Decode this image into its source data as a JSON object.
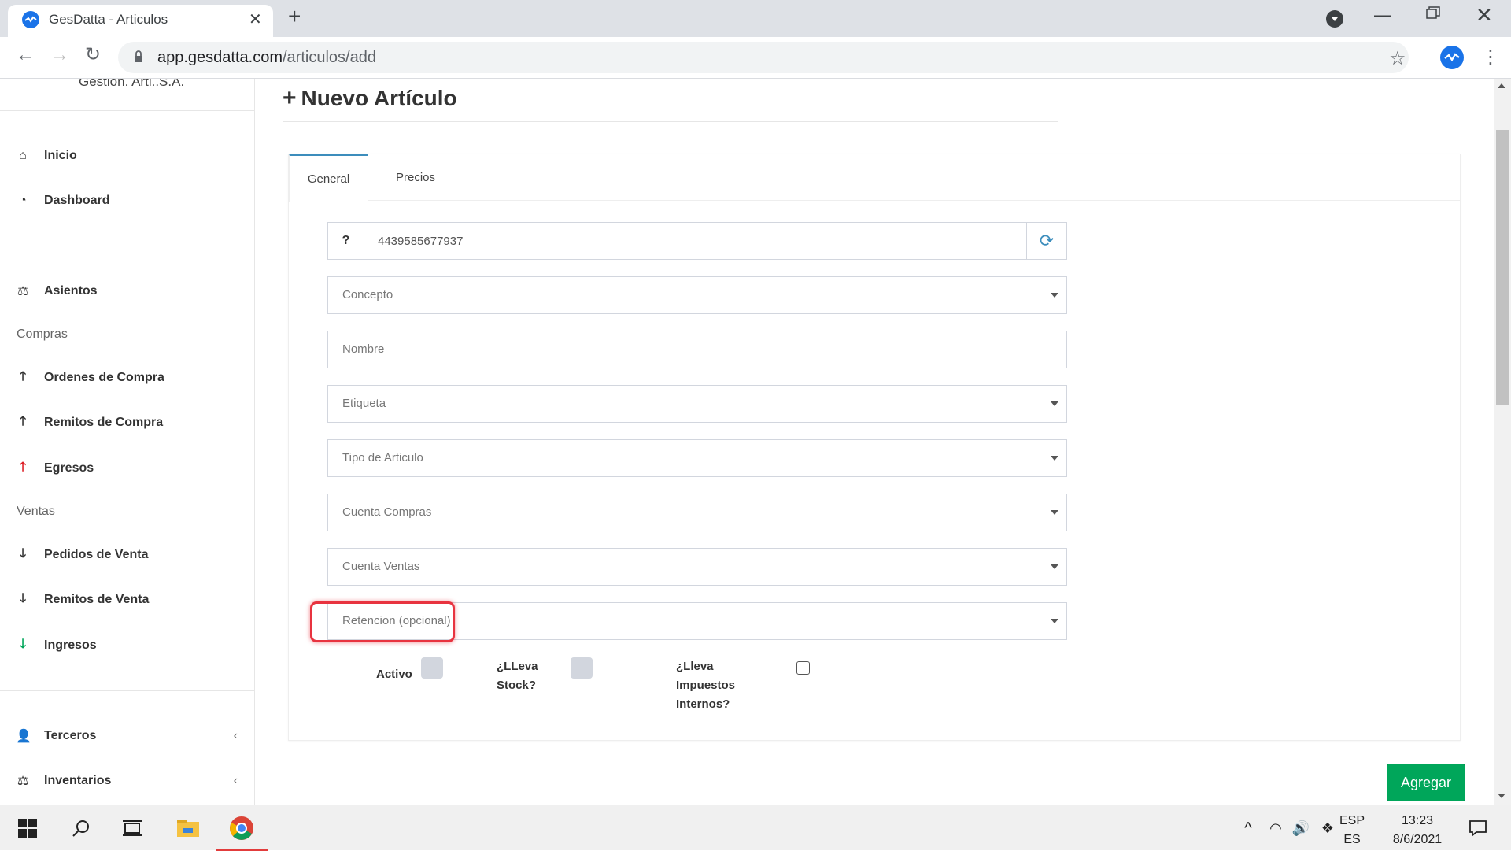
{
  "browser": {
    "tab_title": "GesDatta - Articulos",
    "url_host": "app.gesdatta.com",
    "url_path": "/articulos/add"
  },
  "sidebar": {
    "top_text": "Gestion. Arti..S.A.",
    "items_top": [
      {
        "label": "Inicio",
        "icon": "home-icon"
      },
      {
        "label": "Dashboard",
        "icon": "tachometer-icon"
      }
    ],
    "asientos": {
      "label": "Asientos",
      "icon": "balance-scale-icon"
    },
    "compras_header": "Compras",
    "compras": [
      {
        "label": "Ordenes de Compra",
        "icon": "arrow-up-icon"
      },
      {
        "label": "Remitos de Compra",
        "icon": "arrow-up-icon"
      },
      {
        "label": "Egresos",
        "icon": "arrow-up-red-icon"
      }
    ],
    "ventas_header": "Ventas",
    "ventas": [
      {
        "label": "Pedidos de Venta",
        "icon": "arrow-down-icon"
      },
      {
        "label": "Remitos de Venta",
        "icon": "arrow-down-icon"
      },
      {
        "label": "Ingresos",
        "icon": "arrow-down-green-icon"
      }
    ],
    "bottom": [
      {
        "label": "Terceros",
        "icon": "user-plus-icon"
      },
      {
        "label": "Inventarios",
        "icon": "balance-scale-icon"
      }
    ]
  },
  "main": {
    "title": "Nuevo Artículo",
    "tabs": [
      "General",
      "Precios"
    ],
    "code": {
      "help": "?",
      "value": "4439585677937"
    },
    "fields": {
      "concepto": "Concepto",
      "nombre": "Nombre",
      "etiqueta": "Etiqueta",
      "tipo": "Tipo de Articulo",
      "cuenta_compras": "Cuenta Compras",
      "cuenta_ventas": "Cuenta Ventas",
      "retencion": "Retencion (opcional)"
    },
    "checks": {
      "activo": "Activo",
      "lleva_stock_1": "¿LLeva",
      "lleva_stock_2": "Stock?",
      "imp_1": "¿Lleva",
      "imp_2": "Impuestos",
      "imp_3": "Internos?"
    },
    "submit": "Agregar"
  },
  "taskbar": {
    "lang_1": "ESP",
    "lang_2": "ES",
    "time": "13:23",
    "date": "8/6/2021"
  },
  "colors": {
    "accent": "#3c8dbc",
    "success": "#00a65a",
    "highlight": "#e8333f"
  }
}
